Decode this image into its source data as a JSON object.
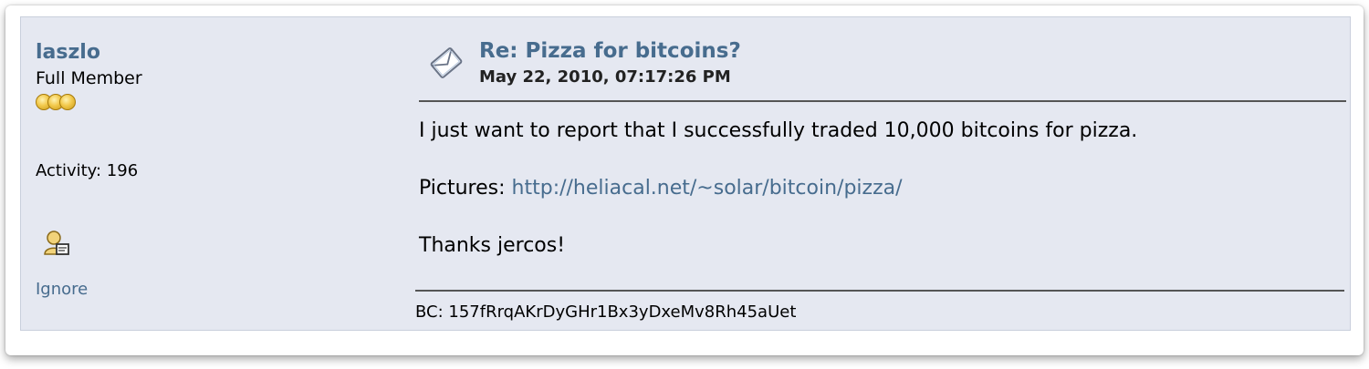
{
  "poster": {
    "username": "laszlo",
    "rank": "Full Member",
    "star_count": 3,
    "activity": "Activity: 196",
    "ignore_label": "Ignore"
  },
  "post": {
    "subject": "Re: Pizza for bitcoins?",
    "date": "May 22, 2010, 07:17:26 PM",
    "line1": "I just want to report that I successfully traded 10,000 bitcoins for pizza.",
    "pictures_label": "Pictures: ",
    "pictures_link": "http://heliacal.net/~solar/bitcoin/pizza/",
    "line3": "Thanks jercos!",
    "signature": "BC: 157fRrqAKrDyGHr1Bx3yDxeMv8Rh45aUet"
  },
  "colors": {
    "link": "#476c8e",
    "post_background": "#e5e8f1",
    "rule": "#555555"
  },
  "icons": {
    "subject": "message-icon",
    "profile": "profile-icon",
    "rank": "star-icon"
  }
}
